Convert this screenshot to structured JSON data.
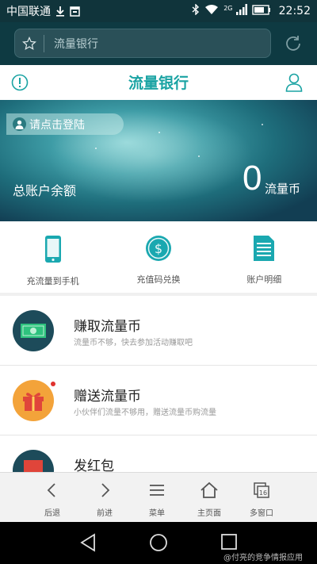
{
  "status_bar": {
    "carrier": "中国联通",
    "network_small": "2G",
    "time": "22:52"
  },
  "browser": {
    "url_text": "流量银行",
    "star_icon": "star-icon",
    "reload_icon": "reload-icon"
  },
  "header": {
    "title": "流量银行"
  },
  "banner": {
    "login_label": "请点击登陆",
    "balance_label": "总账户余额",
    "balance_value": "0",
    "balance_unit": "流量币"
  },
  "quick_actions": [
    {
      "label": "充流量到手机",
      "icon": "phone-icon"
    },
    {
      "label": "充值码兑换",
      "icon": "dollar-coin-icon"
    },
    {
      "label": "账户明细",
      "icon": "document-icon"
    }
  ],
  "list_items": [
    {
      "title": "赚取流量币",
      "subtitle": "流量币不够，快去参加活动赚取吧",
      "icon": "money-icon"
    },
    {
      "title": "赠送流量币",
      "subtitle": "小伙伴们流量不够用，赠送流量币购流量",
      "icon": "gift-icon"
    },
    {
      "title": "发红包",
      "subtitle": "",
      "icon": "red-envelope-icon"
    }
  ],
  "toolbar": [
    {
      "label": "后退",
      "icon": "back-icon"
    },
    {
      "label": "前进",
      "icon": "forward-icon"
    },
    {
      "label": "菜单",
      "icon": "menu-icon"
    },
    {
      "label": "主页面",
      "icon": "home-icon"
    },
    {
      "label": "多窗口",
      "icon": "windows-icon",
      "count": "16"
    }
  ],
  "watermark": "@付亮的竞争情报应用",
  "colors": {
    "accent": "#1aa3a3",
    "status_bg": "#10343b",
    "browser_bg": "#0e3a42",
    "earn_circle": "#1d4b5a",
    "gift_circle": "#f3a33a",
    "notify_dot": "#e0322e"
  }
}
